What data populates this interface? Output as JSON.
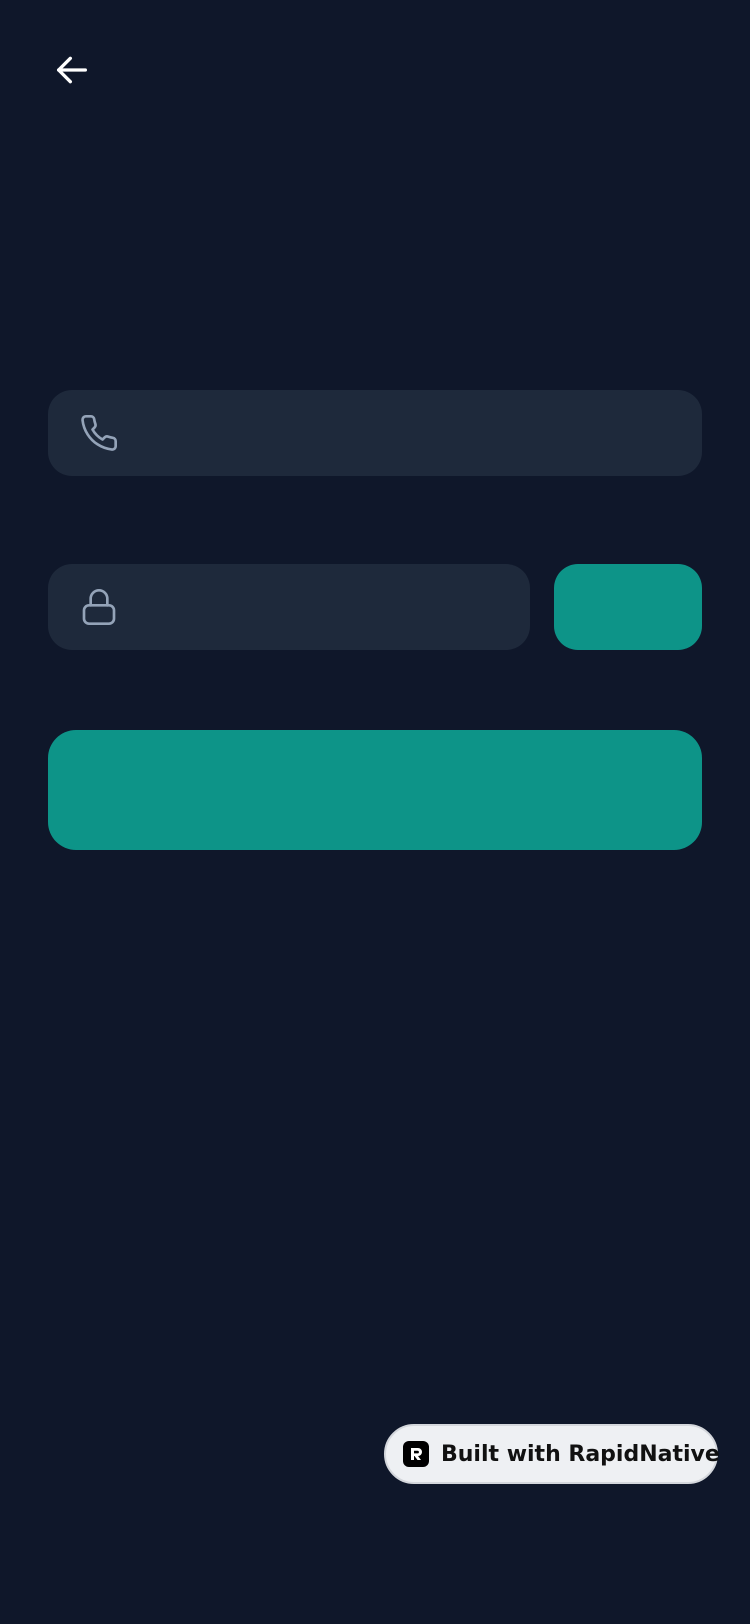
{
  "header": {
    "back_icon": "arrow-left-icon"
  },
  "form": {
    "phone": {
      "icon": "phone-icon",
      "value": "",
      "placeholder": ""
    },
    "code": {
      "icon": "lock-icon",
      "value": "",
      "placeholder": ""
    },
    "send_code_label": "",
    "submit_label": ""
  },
  "badge": {
    "logo": "rapidnative-logo-icon",
    "label": "Built with RapidNative"
  },
  "colors": {
    "background": "#0f172a",
    "field_background": "#1e293b",
    "accent": "#0d9488",
    "icon_muted": "#94a3b8",
    "badge_background": "#eef0f3"
  }
}
